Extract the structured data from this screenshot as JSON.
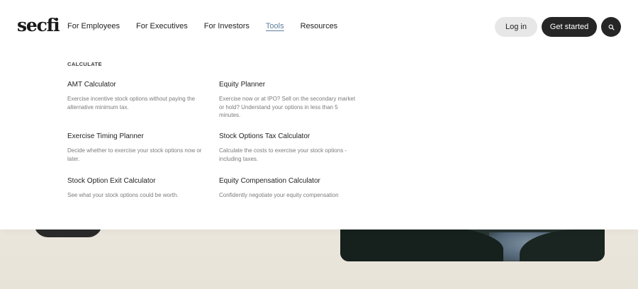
{
  "brand": {
    "logo_text": "secfi"
  },
  "nav": {
    "items": [
      {
        "label": "For Employees"
      },
      {
        "label": "For Executives"
      },
      {
        "label": "For Investors"
      },
      {
        "label": "Tools",
        "active": true
      },
      {
        "label": "Resources"
      }
    ]
  },
  "header": {
    "login_label": "Log in",
    "get_started_label": "Get started",
    "search_icon": "search-icon"
  },
  "dropdown": {
    "section_label": "CALCULATE",
    "tools": [
      {
        "title": "AMT Calculator",
        "description": "Exercise incentive stock options without paying the alternative minimum tax."
      },
      {
        "title": "Equity Planner",
        "description": "Exercise now or at IPO? Sell on the secondary market or hold? Understand your options in less than 5 minutes."
      },
      {
        "title": "Exercise Timing Planner",
        "description": "Decide whether to exercise your stock options now or later."
      },
      {
        "title": "Stock Options Tax Calculator",
        "description": "Calculate the costs to exercise your stock options - including taxes."
      },
      {
        "title": "Stock Option Exit Calculator",
        "description": "See what your stock options could be worth."
      },
      {
        "title": "Equity Compensation Calculator",
        "description": "Confidently negotiate your equity compensation"
      }
    ]
  },
  "colors": {
    "accent": "#5b7f9c",
    "dark_button": "#262626",
    "light_button": "#e6e7e6",
    "page_background": "#f3f1ec"
  }
}
